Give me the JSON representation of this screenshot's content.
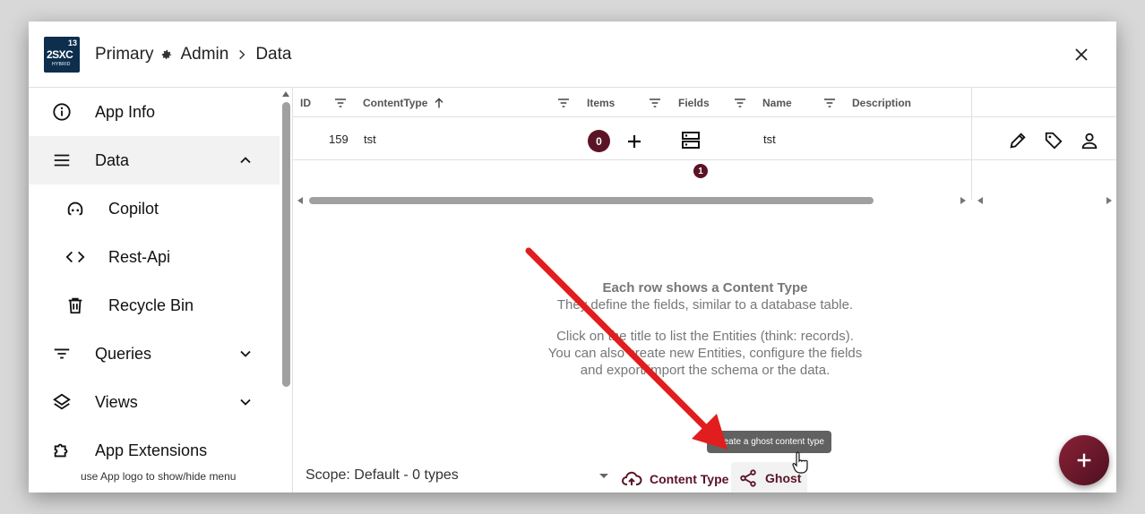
{
  "header": {
    "logo": {
      "number": "13",
      "brand": "2SXC",
      "subtitle": "HYBRID"
    },
    "breadcrumb": [
      "Primary",
      "Admin",
      "Data"
    ],
    "close_icon": "close-icon"
  },
  "sidebar": {
    "items": [
      {
        "label": "App Info",
        "icon": "info-icon"
      },
      {
        "label": "Data",
        "icon": "menu-lines-icon",
        "expanded": true
      },
      {
        "label": "Copilot",
        "icon": "copilot-icon"
      },
      {
        "label": "Rest-Api",
        "icon": "code-icon"
      },
      {
        "label": "Recycle Bin",
        "icon": "trash-icon"
      },
      {
        "label": "Queries",
        "icon": "filter-lines-icon"
      },
      {
        "label": "Views",
        "icon": "layers-icon"
      },
      {
        "label": "App Extensions",
        "icon": "puzzle-icon"
      }
    ],
    "hint": "use App logo to show/hide menu"
  },
  "grid": {
    "columns": [
      "ID",
      "ContentType",
      "Items",
      "Fields",
      "Name",
      "Description"
    ],
    "rows": [
      {
        "id": "159",
        "content_type": "tst",
        "items": "0",
        "fields": "1",
        "name": "tst",
        "description": ""
      }
    ]
  },
  "empty_state": {
    "title": "Each row shows a Content Type",
    "line1": "They define the fields, similar to a database table.",
    "line2": "Click on the title to list the Entities (think: records).",
    "line3": "You can also create new Entities, configure the fields",
    "line4": "and export/import the schema or the data."
  },
  "footer": {
    "scope": "Scope: Default - 0 types",
    "content_type_button": "Content Type",
    "ghost_button": "Ghost",
    "ghost_tooltip": "Create a ghost content type"
  },
  "colors": {
    "accent": "#5a1426",
    "fab": "#7a1c31",
    "annotation": "#e11d1d"
  }
}
